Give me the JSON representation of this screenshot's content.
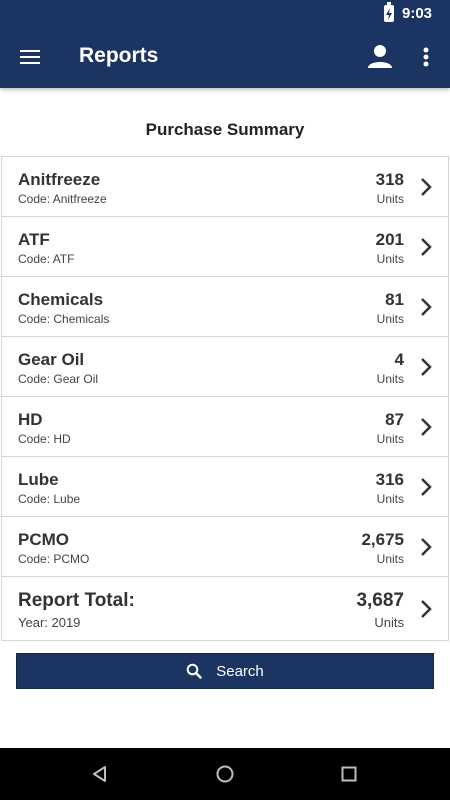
{
  "status_bar": {
    "time": "9:03"
  },
  "app_bar": {
    "title": "Reports"
  },
  "summary": {
    "title": "Purchase Summary",
    "items": [
      {
        "name": "Anitfreeze",
        "code": "Code: Anitfreeze",
        "quantity": "318",
        "unit": "Units"
      },
      {
        "name": "ATF",
        "code": "Code: ATF",
        "quantity": "201",
        "unit": "Units"
      },
      {
        "name": "Chemicals",
        "code": "Code: Chemicals",
        "quantity": "81",
        "unit": "Units"
      },
      {
        "name": "Gear Oil",
        "code": "Code: Gear Oil",
        "quantity": "4",
        "unit": "Units"
      },
      {
        "name": "HD",
        "code": "Code: HD",
        "quantity": "87",
        "unit": "Units"
      },
      {
        "name": "Lube",
        "code": "Code: Lube",
        "quantity": "316",
        "unit": "Units"
      },
      {
        "name": "PCMO",
        "code": "Code: PCMO",
        "quantity": "2,675",
        "unit": "Units"
      }
    ],
    "total": {
      "label": "Report Total:",
      "year": "Year: 2019",
      "quantity": "3,687",
      "unit": "Units"
    }
  },
  "search_button": {
    "label": "Search"
  },
  "colors": {
    "primary": "#1c3461",
    "divider": "#d6d6d6",
    "nav": "#000000"
  },
  "icons": {
    "menu": "menu-icon",
    "account": "account-icon",
    "more": "more-vert-icon",
    "chevron": "chevron-right-icon",
    "search": "search-icon",
    "battery": "battery-charging-icon",
    "back": "back-triangle-icon",
    "home": "home-circle-icon",
    "recents": "recents-square-icon"
  }
}
